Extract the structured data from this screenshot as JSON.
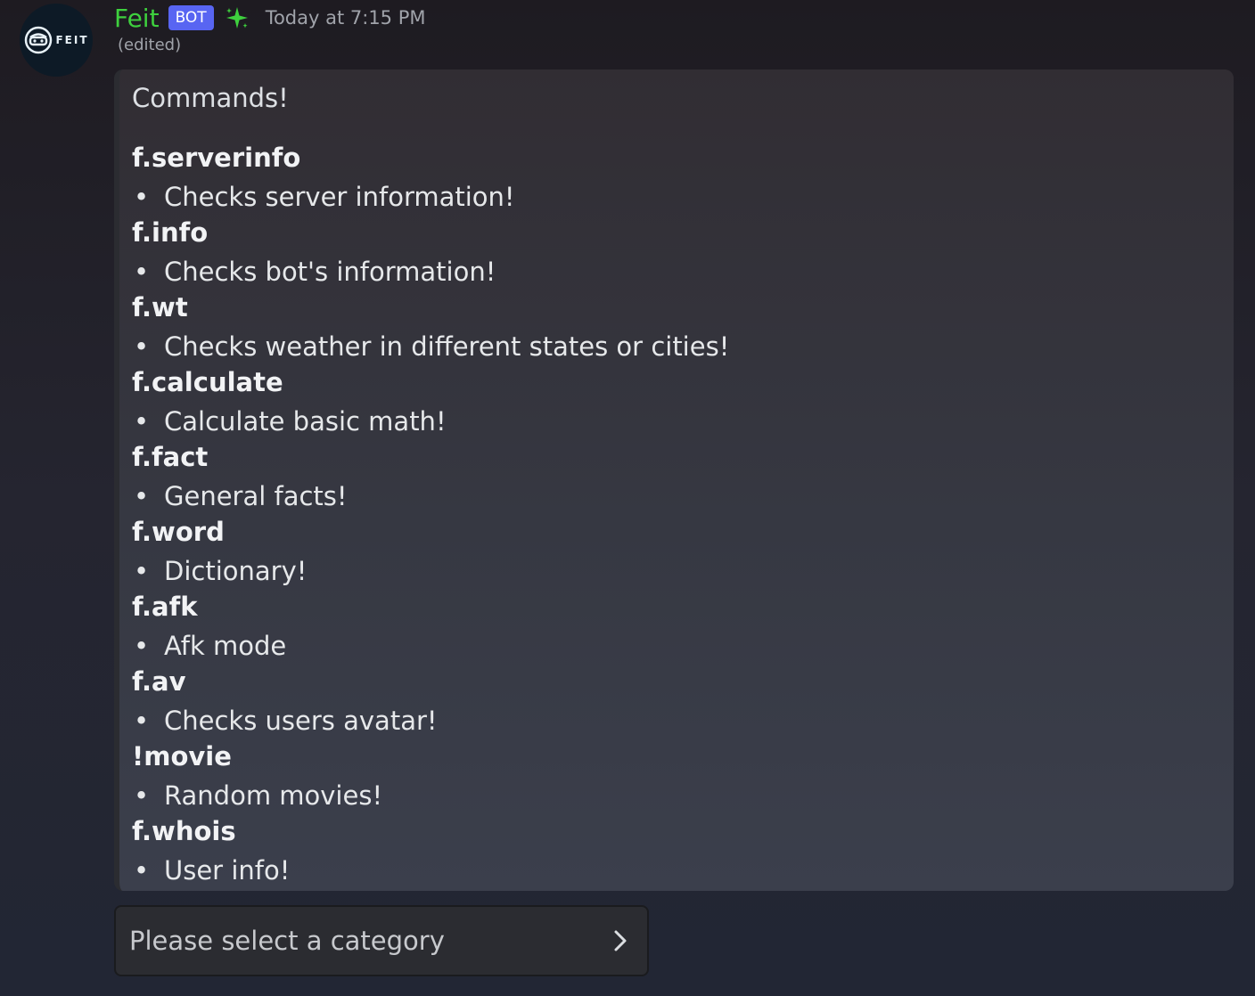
{
  "message": {
    "avatar_text": "FEIT",
    "username": "Feit",
    "bot_tag": "BOT",
    "timestamp": "Today at 7:15 PM",
    "edited": "(edited)",
    "colors": {
      "username": "#3ed13e",
      "bot_tag": "#5865f2",
      "sparkle": "#3ed13e"
    },
    "icons": {
      "avatar": "robot-face-icon",
      "badge": "sparkle-icon",
      "select": "chevron-right-icon"
    }
  },
  "embed": {
    "title": "Commands!",
    "commands": [
      {
        "name": "f.serverinfo",
        "desc": "Checks server information!"
      },
      {
        "name": "f.info",
        "desc": "Checks bot's information!"
      },
      {
        "name": "f.wt",
        "desc": "Checks weather in different states or cities!"
      },
      {
        "name": "f.calculate",
        "desc": "Calculate basic math!"
      },
      {
        "name": "f.fact",
        "desc": "General facts!"
      },
      {
        "name": "f.word",
        "desc": "Dictionary!"
      },
      {
        "name": "f.afk",
        "desc": "Afk mode"
      },
      {
        "name": "f.av",
        "desc": "Checks users avatar!"
      },
      {
        "name": "!movie",
        "desc": "Random movies!"
      },
      {
        "name": "f.whois",
        "desc": "User info!"
      }
    ]
  },
  "select_menu": {
    "placeholder": "Please select a category"
  }
}
